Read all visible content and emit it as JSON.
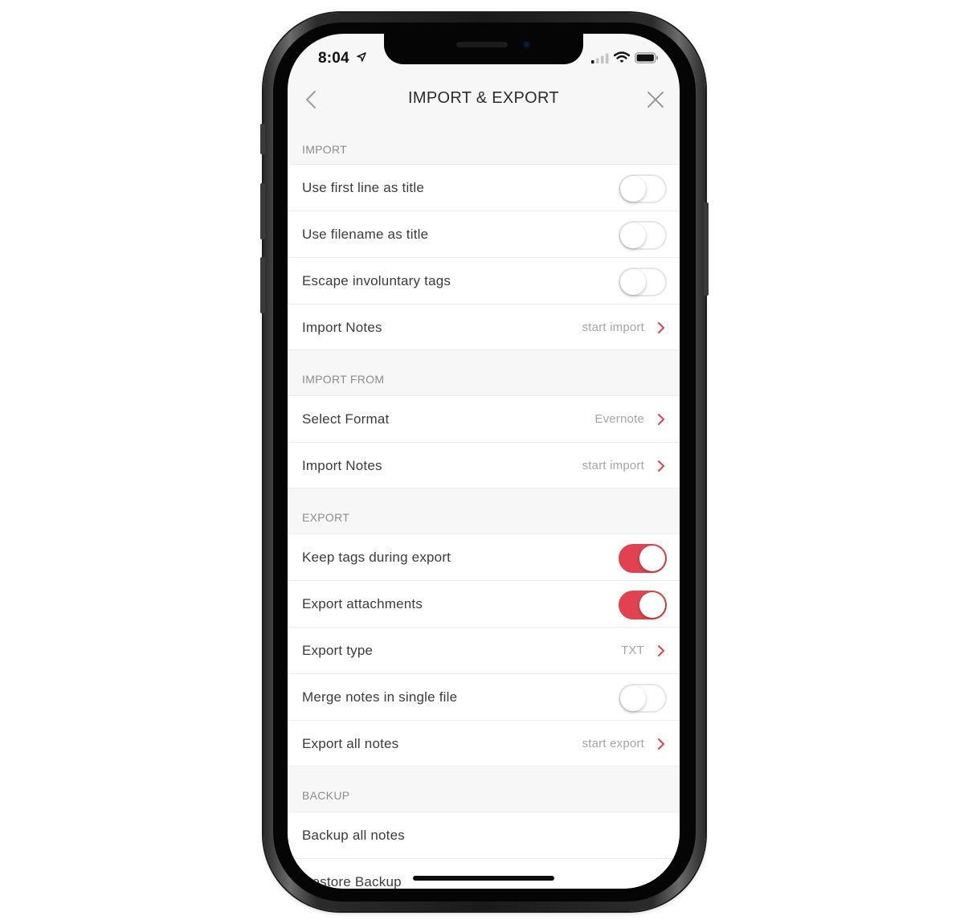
{
  "status_bar": {
    "time": "8:04"
  },
  "nav": {
    "title": "IMPORT & EXPORT"
  },
  "colors": {
    "accent": "#e0434f"
  },
  "sections": {
    "import": {
      "header": "IMPORT",
      "rows": {
        "first_line": {
          "label": "Use first line as title",
          "toggle": false
        },
        "filename": {
          "label": "Use filename as title",
          "toggle": false
        },
        "escape_tags": {
          "label": "Escape involuntary tags",
          "toggle": false
        },
        "import_notes": {
          "label": "Import Notes",
          "value": "start import"
        }
      }
    },
    "import_from": {
      "header": "IMPORT FROM",
      "rows": {
        "select_format": {
          "label": "Select Format",
          "value": "Evernote"
        },
        "import_notes": {
          "label": "Import Notes",
          "value": "start import"
        }
      }
    },
    "export": {
      "header": "EXPORT",
      "rows": {
        "keep_tags": {
          "label": "Keep tags during export",
          "toggle": true
        },
        "attachments": {
          "label": "Export attachments",
          "toggle": true
        },
        "export_type": {
          "label": "Export type",
          "value": "TXT"
        },
        "merge": {
          "label": "Merge notes in single file",
          "toggle": false
        },
        "export_all": {
          "label": "Export all notes",
          "value": "start export"
        }
      }
    },
    "backup": {
      "header": "BACKUP",
      "rows": {
        "backup_all": {
          "label": "Backup all notes"
        },
        "restore": {
          "label": "Restore Backup"
        }
      }
    }
  }
}
